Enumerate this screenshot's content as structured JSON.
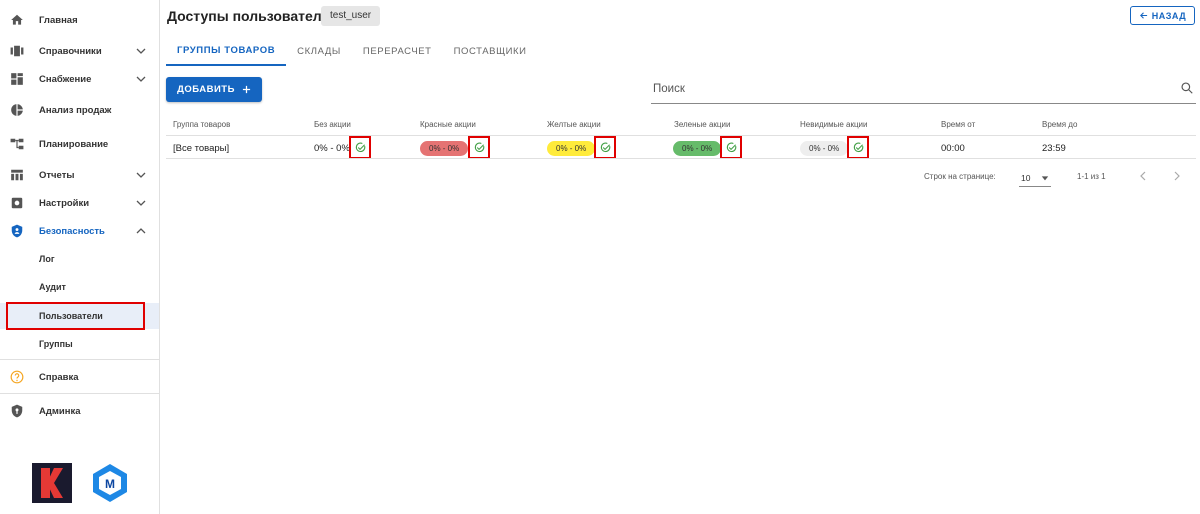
{
  "sidebar": {
    "items": [
      {
        "label": "Главная",
        "icon": "home-icon"
      },
      {
        "label": "Справочники",
        "icon": "directory-icon"
      },
      {
        "label": "Снабжение",
        "icon": "supply-icon"
      },
      {
        "label": "Анализ продаж",
        "icon": "pie-chart-icon"
      },
      {
        "label": "Планирование",
        "icon": "planning-icon"
      },
      {
        "label": "Отчеты",
        "icon": "table-icon"
      },
      {
        "label": "Настройки",
        "icon": "settings-icon"
      },
      {
        "label": "Безопасность",
        "icon": "shield-icon"
      }
    ],
    "security_sub": [
      "Лог",
      "Аудит",
      "Пользователи",
      "Группы"
    ],
    "help": "Справка",
    "admin": "Админка",
    "logo_badge": "М"
  },
  "header": {
    "title": "Доступы пользователя",
    "user_chip": "test_user",
    "back_label": "НАЗАД"
  },
  "tabs": [
    "Группы товаров",
    "Склады",
    "Перерасчет",
    "Поставщики"
  ],
  "toolbar": {
    "add_label": "ДОБАВИТЬ",
    "search_placeholder": "Поиск"
  },
  "table": {
    "headers": [
      "Группа товаров",
      "Без акции",
      "Красные акции",
      "Желтые акции",
      "Зеленые акции",
      "Невидимые акции",
      "Время от",
      "Время до"
    ],
    "rows": [
      {
        "group": "[Все товары]",
        "no_promo": "0% - 0%",
        "red": "0% - 0%",
        "yellow": "0% - 0%",
        "green": "0% - 0%",
        "invisible": "0% - 0%",
        "time_from": "00:00",
        "time_to": "23:59"
      }
    ]
  },
  "pagination": {
    "rows_label": "Строк на странице:",
    "rows_value": "10",
    "range": "1-1 из 1"
  },
  "colors": {
    "accent": "#1565c0",
    "red_pill": "#e57373",
    "yellow_pill": "#ffeb3b",
    "green_pill": "#66bb6a",
    "grey_pill": "#eeeeee",
    "highlight": "#e00000"
  }
}
